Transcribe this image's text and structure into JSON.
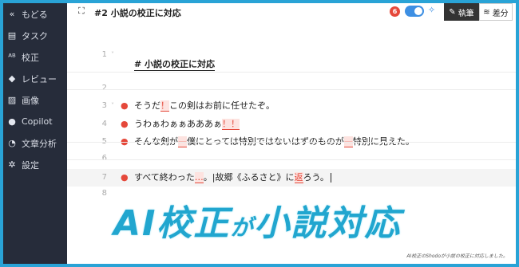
{
  "sidebar": {
    "items": [
      {
        "icon": "«",
        "label": "もどる",
        "name": "back"
      },
      {
        "icon": "▤",
        "label": "タスク",
        "name": "task"
      },
      {
        "icon": "ᴬᴮ",
        "label": "校正",
        "name": "proofread"
      },
      {
        "icon": "◆",
        "label": "レビュー",
        "name": "review"
      },
      {
        "icon": "▨",
        "label": "画像",
        "name": "image"
      },
      {
        "icon": "●",
        "label": "Copilot",
        "name": "copilot"
      },
      {
        "icon": "◔",
        "label": "文章分析",
        "name": "analysis"
      },
      {
        "icon": "✲",
        "label": "設定",
        "name": "settings"
      }
    ]
  },
  "header": {
    "title": "#2 小説の校正に対応",
    "badge": "6",
    "write_label": "執筆",
    "diff_label": "差分",
    "expand_icon": "⛶",
    "wand_icon": "✧"
  },
  "editor": {
    "lines": [
      {
        "num": "1",
        "fold": "˅",
        "dot": "",
        "parts": []
      },
      {
        "num": "",
        "fold": "",
        "dot": "",
        "parts": [
          {
            "t": "# 小説の校正に対応",
            "c": "h"
          }
        ]
      },
      {
        "num": "2",
        "fold": "",
        "dot": "",
        "parts": []
      },
      {
        "num": "3",
        "fold": "˅",
        "dot": "●",
        "parts": [
          {
            "t": "そうだ"
          },
          {
            "t": "！",
            "c": "mark"
          },
          {
            "t": "この剣はお前に任せたぞ。"
          }
        ]
      },
      {
        "num": "4",
        "fold": "",
        "dot": "●",
        "parts": [
          {
            "t": "うわぁわぁぁあああぁ"
          },
          {
            "t": "！！",
            "c": "mark"
          }
        ]
      },
      {
        "num": "5",
        "fold": "",
        "dot": "●",
        "parts": [
          {
            "t": "そんな剣が"
          },
          {
            "t": "—",
            "c": "mark"
          },
          {
            "t": "僕にとっては特別ではないはずのものが"
          },
          {
            "t": "—",
            "c": "mark"
          },
          {
            "t": "特別に見えた。"
          }
        ]
      },
      {
        "num": "6",
        "fold": "",
        "dot": "",
        "parts": []
      },
      {
        "num": "7",
        "fold": "",
        "dot": "●",
        "parts": [
          {
            "t": "すべて終わった"
          },
          {
            "t": "…",
            "c": "mark"
          },
          {
            "t": "。|故郷《ふるさと》に"
          },
          {
            "t": "返",
            "c": "mark"
          },
          {
            "t": "ろう。"
          }
        ]
      },
      {
        "num": "8",
        "fold": "",
        "dot": "",
        "parts": []
      }
    ]
  },
  "banner": {
    "part1": "AI校正",
    "part2": "が",
    "part3": "小説対応",
    "caption": "AI校正のShodoが小説の校正に対応しました。"
  },
  "colors": {
    "sidebar_bg": "#262c3a",
    "accent": "#e5483a",
    "toggle": "#3d8fe3",
    "banner": "#21a6cf",
    "border": "#29a3d6"
  }
}
